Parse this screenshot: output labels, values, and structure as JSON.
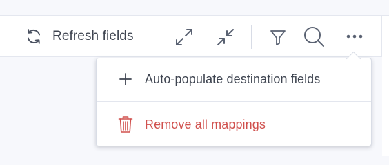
{
  "toolbar": {
    "refresh_label": "Refresh fields",
    "icons": {
      "refresh": "refresh-icon",
      "expand": "expand-icon",
      "collapse": "collapse-icon",
      "filter": "filter-icon",
      "search": "search-icon",
      "more": "more-options-icon"
    }
  },
  "menu": {
    "items": [
      {
        "label": "Auto-populate destination fields",
        "icon": "plus-icon"
      },
      {
        "label": "Remove all mappings",
        "icon": "trash-icon",
        "color": "#d0504d"
      }
    ]
  },
  "colors": {
    "text": "#3e4450",
    "icon": "#5a6272",
    "danger": "#d0504d",
    "divider": "#d8dce6",
    "background": "#f7f8fc"
  }
}
